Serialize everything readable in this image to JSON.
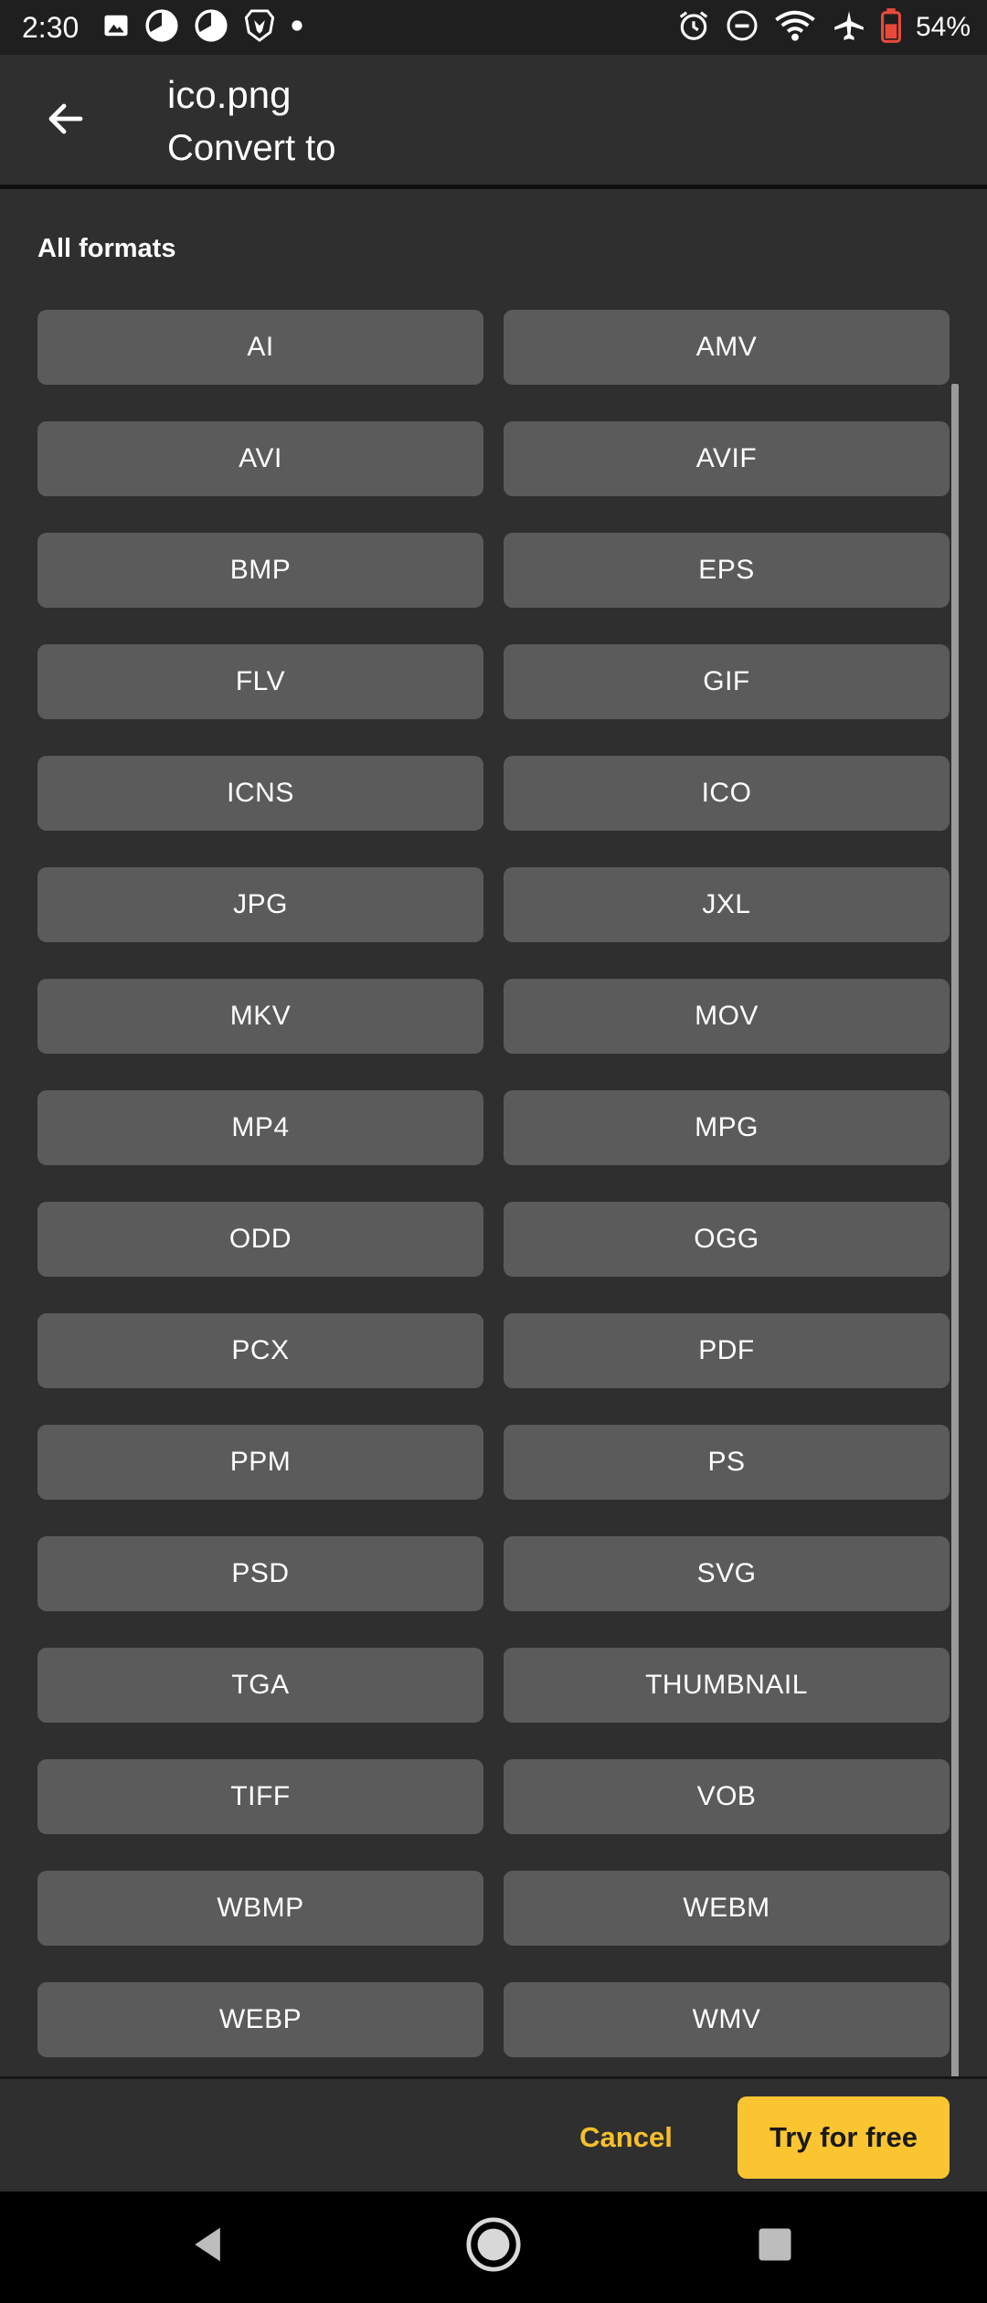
{
  "status_bar": {
    "time": "2:30",
    "battery_percent": "54%",
    "left_icons": [
      "image-icon",
      "pie-icon",
      "pie-icon",
      "brave-icon",
      "dot-icon"
    ],
    "right_icons": [
      "alarm-icon",
      "dnd-icon",
      "wifi-icon",
      "airplane-icon",
      "battery-icon"
    ]
  },
  "app_bar": {
    "title": "ico.png",
    "subtitle": "Convert to",
    "back_icon": "back-arrow-icon"
  },
  "section": {
    "title": "All formats"
  },
  "formats": [
    "AI",
    "AMV",
    "AVI",
    "AVIF",
    "BMP",
    "EPS",
    "FLV",
    "GIF",
    "ICNS",
    "ICO",
    "JPG",
    "JXL",
    "MKV",
    "MOV",
    "MP4",
    "MPG",
    "ODD",
    "OGG",
    "PCX",
    "PDF",
    "PPM",
    "PS",
    "PSD",
    "SVG",
    "TGA",
    "THUMBNAIL",
    "TIFF",
    "VOB",
    "WBMP",
    "WEBM",
    "WEBP",
    "WMV"
  ],
  "actions": {
    "cancel_label": "Cancel",
    "try_label": "Try for free"
  },
  "colors": {
    "accent": "#fbc531",
    "accent_text": "#f6c02c",
    "background": "#2f2f2f",
    "button": "#5b5b5b"
  }
}
